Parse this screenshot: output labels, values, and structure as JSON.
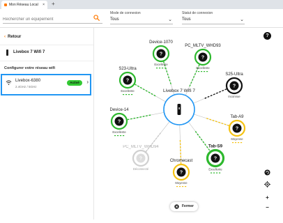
{
  "tabbar": {
    "tab_title": "Mon Réseau Local",
    "close": "×",
    "new_tab": "+"
  },
  "filters": {
    "search_placeholder": "Rechercher un équipement",
    "connection_mode": {
      "label": "Mode de connexion",
      "value": "Tous"
    },
    "connection_status": {
      "label": "Statut de connexion",
      "value": "Tous"
    }
  },
  "sidebar": {
    "back_label": "Retour",
    "device_name": "Livebox 7 Wifi 7",
    "section_title": "Configurer votre réseau wifi",
    "wifi": {
      "name": "Livebox-6380",
      "bands": "2.4GHz / 5GHz",
      "status": "Activé"
    }
  },
  "map": {
    "hub": {
      "label": "Livebox 7 Wifi 7"
    },
    "devices": [
      {
        "id": "device-1070",
        "label": "Device-1070",
        "status": "Excellente",
        "ring": "#2db82d",
        "style": "normal",
        "bars": "green",
        "link": "green"
      },
      {
        "id": "pc-mltv-whd93",
        "label": "PC_MLTV_WHD93",
        "status": "Excellente",
        "ring": "#2db82d",
        "style": "normal",
        "bars": "green",
        "link": "green"
      },
      {
        "id": "s23-ultra",
        "label": "S23-Ultra",
        "status": "Excellente",
        "ring": "#2db82d",
        "style": "normal",
        "bars": "green",
        "link": "green"
      },
      {
        "id": "s25-ultra",
        "label": "S25-Ultra",
        "status": "Inconnue",
        "ring": "#111111",
        "style": "normal",
        "bars": "none",
        "link": "black"
      },
      {
        "id": "device-14",
        "label": "Device-14",
        "status": "Excellente",
        "ring": "#2db82d",
        "style": "normal",
        "bars": "green",
        "link": "green"
      },
      {
        "id": "tab-a9",
        "label": "Tab-A9",
        "status": "Moyenne",
        "ring": "#f5c211",
        "style": "normal",
        "bars": "yellow",
        "link": "yellow"
      },
      {
        "id": "pc-mltv-whd94",
        "label": "PC_MLTV_WHD94",
        "status": "Déconnecté",
        "ring": "#c8c8c8",
        "style": "faded",
        "bars": "none",
        "link": "gray"
      },
      {
        "id": "chromecast",
        "label": "Chromecast",
        "status": "Moyenne",
        "ring": "#f5c211",
        "style": "normal",
        "bars": "yellow",
        "link": "yellow"
      },
      {
        "id": "tab-s9",
        "label": "Tab-S9",
        "status": "Excellente",
        "ring": "#2db82d",
        "style": "thick",
        "bars": "green",
        "link": "green"
      }
    ],
    "close_label": "Fermer",
    "help": "?",
    "controls": {
      "zoom_in": "+",
      "zoom_out": "−"
    }
  }
}
